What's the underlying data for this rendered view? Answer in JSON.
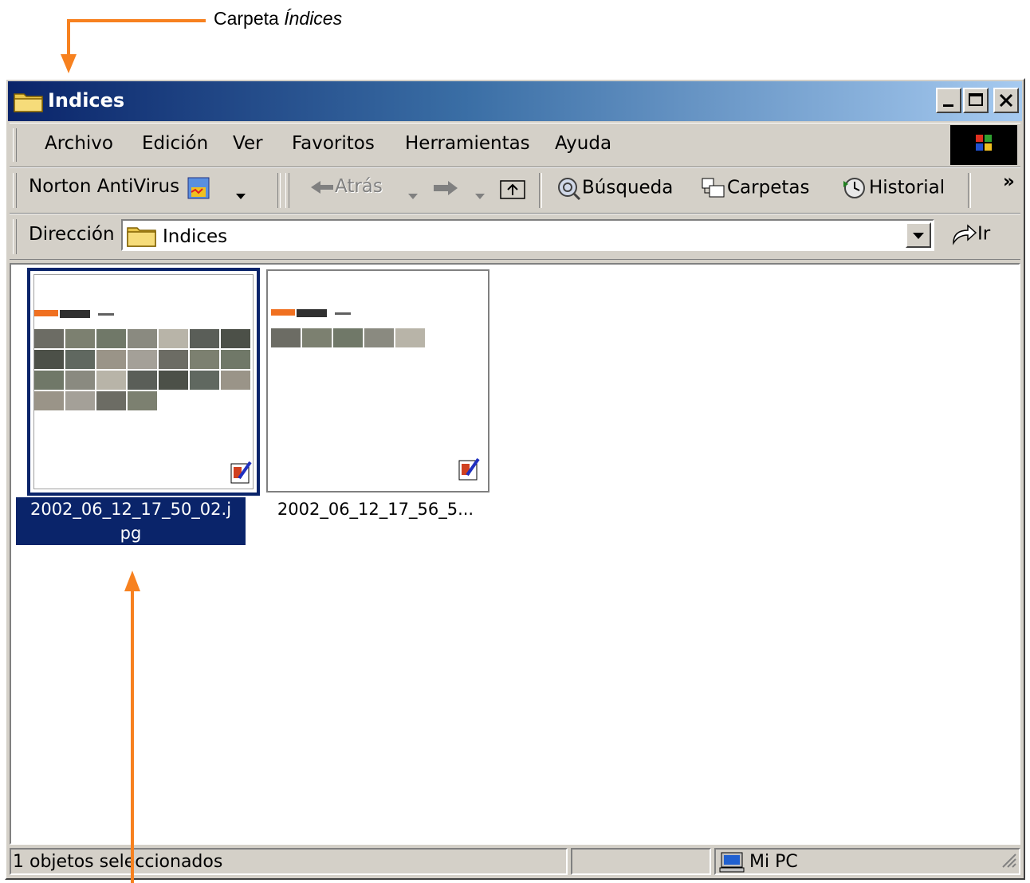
{
  "annotation": {
    "label_prefix": "Carpeta ",
    "label_emphasis": "Índices"
  },
  "window": {
    "title": "Indices",
    "buttons": {
      "minimize": "minimize-icon",
      "maximize": "maximize-icon",
      "close": "close-icon"
    }
  },
  "menubar": {
    "items": [
      "Archivo",
      "Edición",
      "Ver",
      "Favoritos",
      "Herramientas",
      "Ayuda"
    ]
  },
  "toolbar": {
    "norton_label": "Norton AntiVirus",
    "back_label": "Atrás",
    "search_label": "Búsqueda",
    "folders_label": "Carpetas",
    "history_label": "Historial",
    "more_label": "»"
  },
  "address": {
    "label": "Dirección",
    "value": "Indices",
    "go_label": "Ir"
  },
  "files": [
    {
      "name": "2002_06_12_17_50_02.jpg",
      "name_line1": "2002_06_12_17_50_02.j",
      "name_line2": "pg",
      "selected": true
    },
    {
      "name_display": "2002_06_12_17_56_5...",
      "selected": false
    }
  ],
  "status": {
    "selection": "1 objetos seleccionados",
    "zone": "Mi PC"
  },
  "colors": {
    "accent_arrow": "#f7811f",
    "selection": "#0a246a",
    "title_start": "#0a246a",
    "title_end": "#a6caf0"
  }
}
